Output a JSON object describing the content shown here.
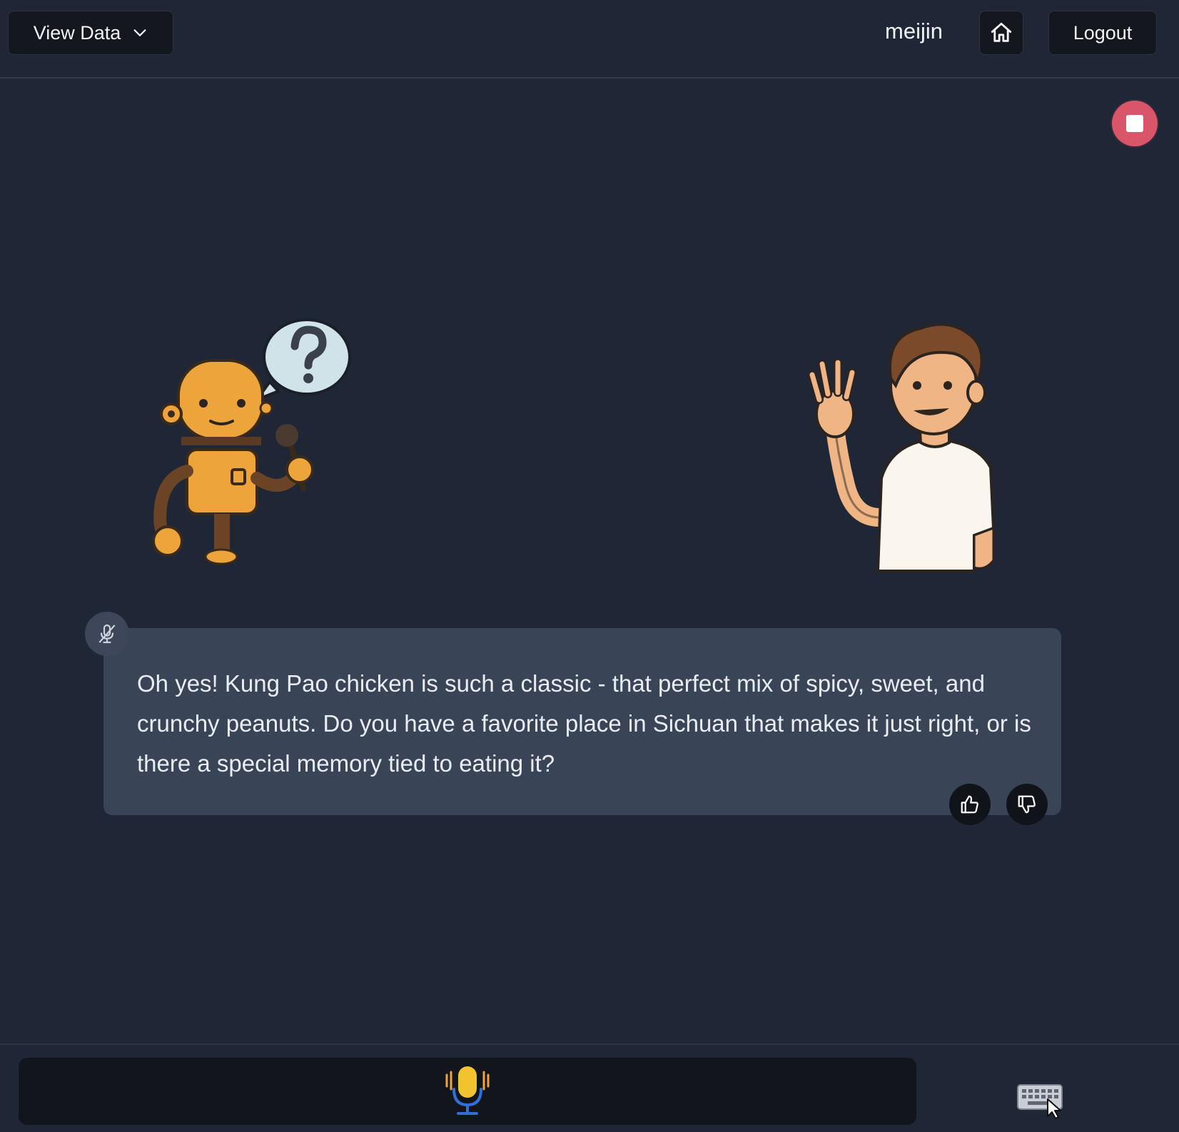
{
  "header": {
    "view_data_label": "View Data",
    "username": "meijin",
    "logout_label": "Logout"
  },
  "message": {
    "text": "Oh yes! Kung Pao chicken is such a classic - that perfect mix of spicy, sweet, and crunchy peanuts. Do you have a favorite place in Sichuan that makes it just right, or is there a special memory tied to eating it?"
  },
  "icons": {
    "dropdown": "chevron-down-icon",
    "home": "home-icon",
    "stop": "stop-icon",
    "mute": "mic-off-icon",
    "thumbs_up": "thumbs-up-icon",
    "thumbs_down": "thumbs-down-icon",
    "mic": "mic-icon",
    "keyboard": "keyboard-icon"
  },
  "colors": {
    "background": "#1f2636",
    "card": "#3a4457",
    "stop": "#d9566a",
    "mic": "#f2c230"
  }
}
